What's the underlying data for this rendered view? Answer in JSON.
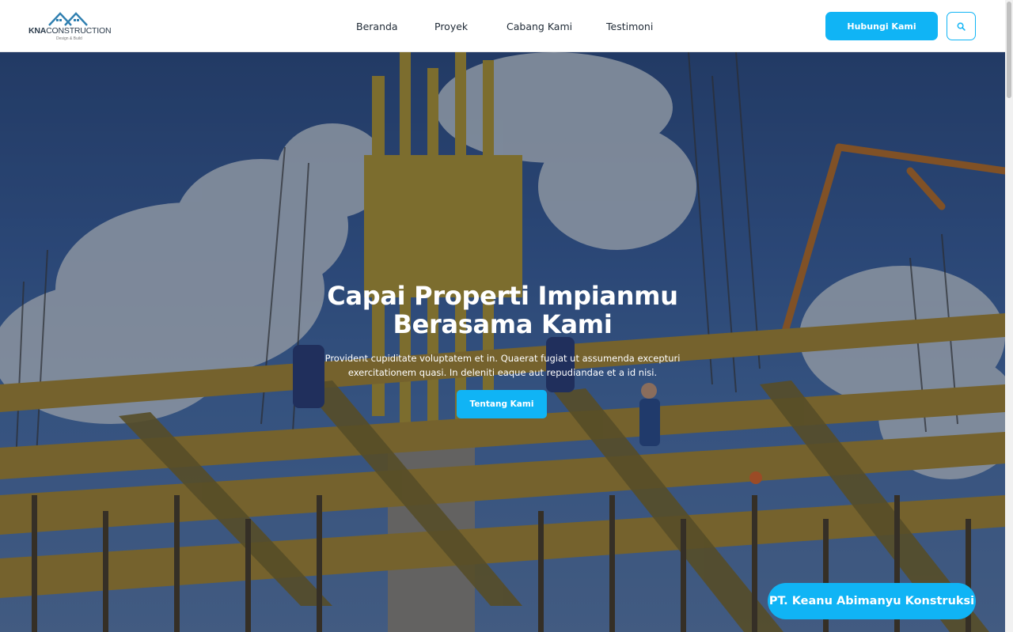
{
  "brand": {
    "logo_name": "KNA",
    "logo_word": "CONSTRUCTION",
    "logo_tagline": "Design & Build"
  },
  "nav": {
    "items": [
      {
        "label": "Beranda"
      },
      {
        "label": "Proyek"
      },
      {
        "label": "Cabang Kami"
      },
      {
        "label": "Testimoni"
      }
    ],
    "contact_label": "Hubungi Kami",
    "search_icon": "search-icon"
  },
  "hero": {
    "title_line1": "Capai Properti Impianmu",
    "title_line2": "Berasama Kami",
    "description": "Provident cupiditate voluptatem et in. Quaerat fugiat ut assumenda excepturi exercitationem quasi. In deleniti eaque aut repudiandae et a id nisi.",
    "cta_label": "Tentang Kami"
  },
  "floating": {
    "company_label": "PT. Keanu Abimanyu Konstruksi"
  },
  "colors": {
    "accent": "#10b4f5",
    "nav_text": "#1f2a36",
    "header_bg": "#ffffff"
  }
}
